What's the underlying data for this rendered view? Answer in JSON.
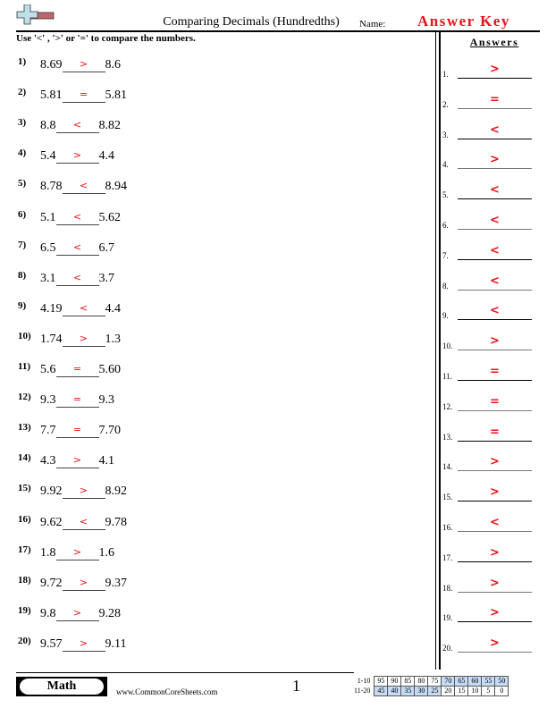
{
  "header": {
    "title": "Comparing Decimals (Hundredths)",
    "name_label": "Name:",
    "answer_key": "Answer Key",
    "instructions": "Use '<' , '>' or '=' to compare the numbers.",
    "logo": "plus-minus-logo-icon"
  },
  "answers_title": "Answers",
  "problems": [
    {
      "num": "1)",
      "left": "8.69",
      "answer": ">",
      "right": "8.6"
    },
    {
      "num": "2)",
      "left": "5.81",
      "answer": "=",
      "right": "5.81"
    },
    {
      "num": "3)",
      "left": "8.8",
      "answer": "<",
      "right": "8.82"
    },
    {
      "num": "4)",
      "left": "5.4",
      "answer": ">",
      "right": "4.4"
    },
    {
      "num": "5)",
      "left": "8.78",
      "answer": "<",
      "right": "8.94"
    },
    {
      "num": "6)",
      "left": "5.1",
      "answer": "<",
      "right": "5.62"
    },
    {
      "num": "7)",
      "left": "6.5",
      "answer": "<",
      "right": "6.7"
    },
    {
      "num": "8)",
      "left": "3.1",
      "answer": "<",
      "right": "3.7"
    },
    {
      "num": "9)",
      "left": "4.19",
      "answer": "<",
      "right": "4.4"
    },
    {
      "num": "10)",
      "left": "1.74",
      "answer": ">",
      "right": "1.3"
    },
    {
      "num": "11)",
      "left": "5.6",
      "answer": "=",
      "right": "5.60"
    },
    {
      "num": "12)",
      "left": "9.3",
      "answer": "=",
      "right": "9.3"
    },
    {
      "num": "13)",
      "left": "7.7",
      "answer": "=",
      "right": "7.70"
    },
    {
      "num": "14)",
      "left": "4.3",
      "answer": ">",
      "right": "4.1"
    },
    {
      "num": "15)",
      "left": "9.92",
      "answer": ">",
      "right": "8.92"
    },
    {
      "num": "16)",
      "left": "9.62",
      "answer": "<",
      "right": "9.78"
    },
    {
      "num": "17)",
      "left": "1.8",
      "answer": ">",
      "right": "1.6"
    },
    {
      "num": "18)",
      "left": "9.72",
      "answer": ">",
      "right": "9.37"
    },
    {
      "num": "19)",
      "left": "9.8",
      "answer": ">",
      "right": "9.28"
    },
    {
      "num": "20)",
      "left": "9.57",
      "answer": ">",
      "right": "9.11"
    }
  ],
  "answer_key_list": [
    {
      "num": "1.",
      "value": ">"
    },
    {
      "num": "2.",
      "value": "="
    },
    {
      "num": "3.",
      "value": "<"
    },
    {
      "num": "4.",
      "value": ">"
    },
    {
      "num": "5.",
      "value": "<"
    },
    {
      "num": "6.",
      "value": "<"
    },
    {
      "num": "7.",
      "value": "<"
    },
    {
      "num": "8.",
      "value": "<"
    },
    {
      "num": "9.",
      "value": "<"
    },
    {
      "num": "10.",
      "value": ">"
    },
    {
      "num": "11.",
      "value": "="
    },
    {
      "num": "12.",
      "value": "="
    },
    {
      "num": "13.",
      "value": "="
    },
    {
      "num": "14.",
      "value": ">"
    },
    {
      "num": "15.",
      "value": ">"
    },
    {
      "num": "16.",
      "value": "<"
    },
    {
      "num": "17.",
      "value": ">"
    },
    {
      "num": "18.",
      "value": ">"
    },
    {
      "num": "19.",
      "value": ">"
    },
    {
      "num": "20.",
      "value": ">"
    }
  ],
  "footer": {
    "subject": "Math",
    "website": "www.CommonCoreSheets.com",
    "page": "1",
    "score_table": [
      {
        "label": "1-10",
        "cells": [
          "95",
          "90",
          "85",
          "80",
          "75",
          "70",
          "65",
          "60",
          "55",
          "50"
        ],
        "highlight": [
          false,
          false,
          false,
          false,
          false,
          true,
          true,
          true,
          true,
          true
        ]
      },
      {
        "label": "11-20",
        "cells": [
          "45",
          "40",
          "35",
          "30",
          "25",
          "20",
          "15",
          "10",
          "5",
          "0"
        ],
        "highlight": [
          true,
          true,
          true,
          true,
          true,
          false,
          false,
          false,
          false,
          false
        ]
      }
    ]
  },
  "colors": {
    "answer_red": "#e8131b",
    "score_highlight": "#c6dbf6",
    "logo_plus": "#bfe0e8",
    "logo_minus": "#c0666a"
  }
}
